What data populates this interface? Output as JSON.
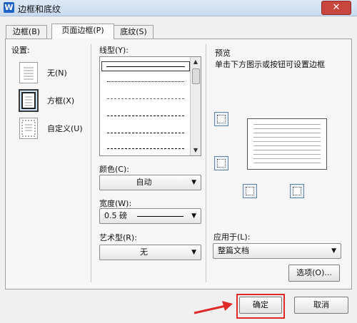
{
  "window": {
    "title": "边框和底纹",
    "app_icon": "W",
    "close_symbol": "✕"
  },
  "tabs": [
    {
      "label": "边框(B)",
      "active": false
    },
    {
      "label": "页面边框(P)",
      "active": true
    },
    {
      "label": "底纹(S)",
      "active": false
    }
  ],
  "settings": {
    "label": "设置:",
    "options": [
      {
        "label": "无(N)",
        "selected": false
      },
      {
        "label": "方框(X)",
        "selected": true
      },
      {
        "label": "自定义(U)",
        "selected": false
      }
    ]
  },
  "line_style": {
    "label": "线型(Y):"
  },
  "color": {
    "label": "颜色(C):",
    "value": "自动"
  },
  "width": {
    "label": "宽度(W):",
    "value": "0.5   磅"
  },
  "art": {
    "label": "艺术型(R):",
    "value": "无"
  },
  "preview": {
    "label": "预览",
    "hint": "单击下方图示或按钮可设置边框"
  },
  "apply_to": {
    "label": "应用于(L):",
    "value": "整篇文档"
  },
  "buttons": {
    "options": "选项(O)...",
    "ok": "确定",
    "cancel": "取消"
  },
  "colors": {
    "highlight": "#e02a2a",
    "accent": "#1f63c6"
  }
}
